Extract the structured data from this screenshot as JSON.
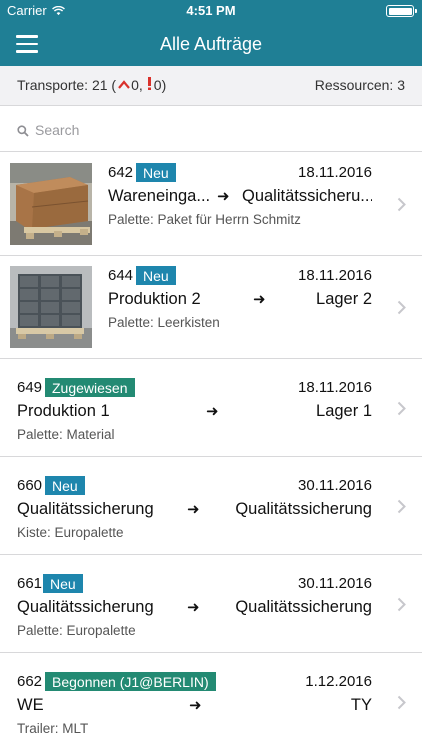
{
  "status_bar": {
    "carrier": "Carrier",
    "time": "4:51 PM",
    "wifi_icon": "wifi-icon",
    "battery_level": 1.0
  },
  "nav": {
    "title": "Alle Aufträge",
    "menu_icon": "hamburger-menu-icon"
  },
  "summary": {
    "transporte_label": "Transporte: 21 (",
    "up_value": "0,",
    "excl_value": "0)",
    "ressourcen_label": "Ressourcen: 3",
    "up_color": "#d9312b"
  },
  "search": {
    "placeholder": "Search",
    "value": ""
  },
  "colors": {
    "accent": "#1f7f95",
    "badge_neu": "#1e86ad",
    "badge_green": "#238a73"
  },
  "orders": [
    {
      "number": "642",
      "badge": "Neu",
      "date": "18.11.2016",
      "from": "Wareneinga...",
      "to": "Qualitätssicheru...",
      "detail": "Palette: Paket für Herrn Schmitz",
      "image": "cardboard-box-on-pallet"
    },
    {
      "number": "644",
      "badge": "Neu",
      "date": "18.11.2016",
      "from": "Produktion 2",
      "to": "Lager 2",
      "detail": "Palette: Leerkisten",
      "image": "stacked-crates-on-pallet"
    },
    {
      "number": "649",
      "badge": "Zugewiesen",
      "date": "18.11.2016",
      "from": "Produktion 1",
      "to": "Lager 1",
      "detail": "Palette: Material"
    },
    {
      "number": "660",
      "badge": "Neu",
      "date": "30.11.2016",
      "from": "Qualitätssicherung",
      "to": "Qualitätssicherung",
      "detail": "Kiste: Europalette"
    },
    {
      "number": "661",
      "badge": "Neu",
      "date": "30.11.2016",
      "from": "Qualitätssicherung",
      "to": "Qualitätssicherung",
      "detail": "Palette: Europalette"
    },
    {
      "number": "662",
      "badge": "Begonnen (J1@BERLIN)",
      "date": "1.12.2016",
      "from": "WE",
      "to": "TY",
      "detail": "Trailer: MLT"
    }
  ]
}
